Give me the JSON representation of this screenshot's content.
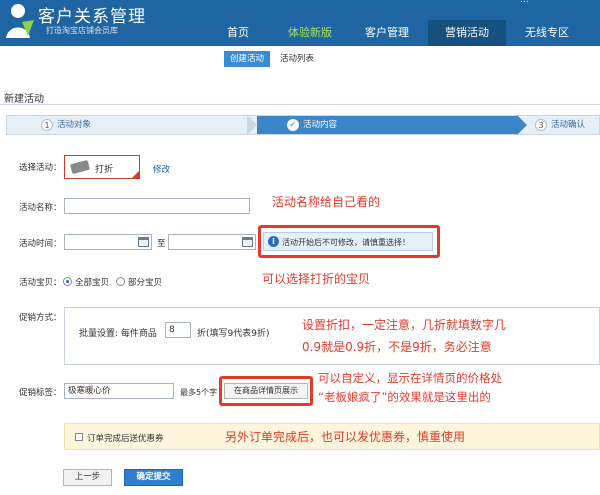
{
  "header": {
    "brand_title": "客户关系管理",
    "brand_subtitle": "打造淘宝店铺会员库",
    "corner_text": "...",
    "nav": [
      {
        "label": "首页"
      },
      {
        "label": "体验新版"
      },
      {
        "label": "客户管理"
      },
      {
        "label": "营销活动"
      },
      {
        "label": "无线专区"
      }
    ]
  },
  "subnav": {
    "active": "创建活动",
    "other": "活动列表"
  },
  "page_title": "新建活动",
  "steps": [
    {
      "num": "1",
      "label": "活动对象"
    },
    {
      "label": "活动内容"
    },
    {
      "num": "3",
      "label": "活动确认"
    }
  ],
  "form": {
    "select_activity_label": "选择活动：",
    "activity_name_value": "打折",
    "modify_link": "修改",
    "name_label": "活动名称：",
    "name_value": "",
    "time_label": "活动时间：",
    "time_to": "至",
    "time_start": "",
    "time_end": "",
    "time_info": "活动开始后不可修改，请慎重选择！",
    "items_label": "活动宝贝：",
    "all_items": "全部宝贝",
    "some_items": "部分宝贝",
    "discount_label": "促销方式：",
    "bulk_label": "批量设置: 每件商品",
    "discount_value": "8",
    "discount_unit": "折(填写9代表9折)",
    "tag_label": "促销标签：",
    "tag_value": "极寒暖心价",
    "tag_limit": "最多5个字",
    "tag_button": "在商品详情页展示",
    "coupon_checkbox": "订单完成后送优惠券",
    "btn_prev": "上一步",
    "btn_submit": "确定提交"
  },
  "annotations": {
    "name_note": "活动名称给自己看的",
    "items_note": "可以选择打折的宝贝",
    "discount_note_1": "设置折扣，一定注意，几折就填数字几",
    "discount_note_2": "0.9就是0.9折，不是9折，务必注意",
    "tag_note_1": "可以自定义，显示在详情页的价格处",
    "tag_note_2": "“老板娘疯了”的效果就是这里出的",
    "coupon_note": "另外订单完成后，也可以发优惠券，慎重使用"
  },
  "colors": {
    "header_bg": "#1f65a3",
    "accent_blue": "#2f7fd0",
    "annotation_red": "#e53a2a"
  }
}
